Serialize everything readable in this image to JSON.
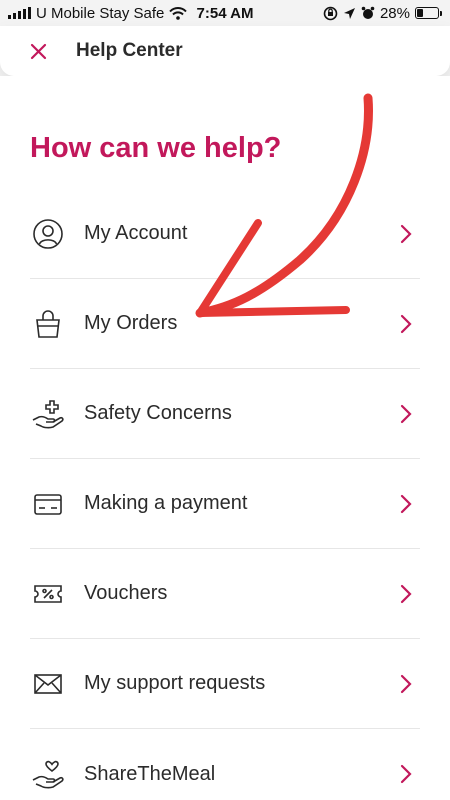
{
  "status_bar": {
    "carrier": "U Mobile Stay Safe",
    "time": "7:54 AM",
    "battery_percent": "28%",
    "battery_level": 0.28
  },
  "header": {
    "title": "Help Center",
    "close_icon": "close-icon"
  },
  "main": {
    "heading": "How can we help?",
    "items": [
      {
        "label": "My Account",
        "icon": "account-icon"
      },
      {
        "label": "My Orders",
        "icon": "shopping-bag-icon"
      },
      {
        "label": "Safety Concerns",
        "icon": "hand-plus-icon"
      },
      {
        "label": "Making a payment",
        "icon": "payment-card-icon"
      },
      {
        "label": "Vouchers",
        "icon": "voucher-icon"
      },
      {
        "label": "My support requests",
        "icon": "envelope-icon"
      },
      {
        "label": "ShareTheMeal",
        "icon": "hand-heart-icon"
      }
    ]
  },
  "colors": {
    "accent": "#c2185b",
    "annotation_arrow": "#e53935"
  }
}
